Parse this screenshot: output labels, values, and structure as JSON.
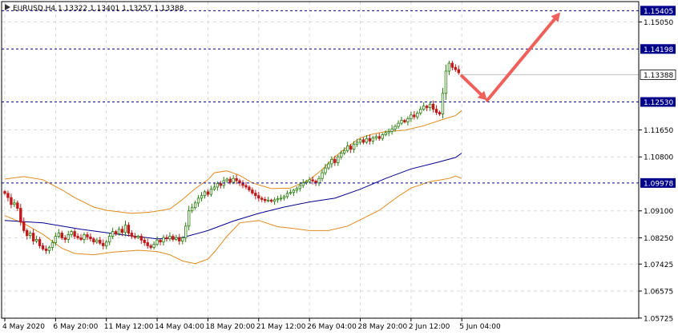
{
  "chart_data": {
    "type": "candlestick",
    "title": "EURUSD,H4  1.13322 1.13401 1.13257 1.13388",
    "ylim": [
      1.0572,
      1.1569
    ],
    "y_ticks": [
      {
        "value": 1.1505,
        "label": "1.15050"
      },
      {
        "value": 1.1165,
        "label": "1.11650"
      },
      {
        "value": 1.108,
        "label": "1.10800"
      },
      {
        "value": 1.091,
        "label": "1.09100"
      },
      {
        "value": 1.0825,
        "label": "1.08250"
      },
      {
        "value": 1.07425,
        "label": "1.07425"
      },
      {
        "value": 1.06575,
        "label": "1.06575"
      },
      {
        "value": 1.05725,
        "label": "1.05725"
      }
    ],
    "x_ticks": [
      {
        "bar": 0,
        "label": "4 May 2020"
      },
      {
        "bar": 16,
        "label": "6 May 20:00"
      },
      {
        "bar": 32,
        "label": "11 May 12:00"
      },
      {
        "bar": 48,
        "label": "14 May 04:00"
      },
      {
        "bar": 64,
        "label": "18 May 20:00"
      },
      {
        "bar": 80,
        "label": "21 May 12:00"
      },
      {
        "bar": 96,
        "label": "26 May 04:00"
      },
      {
        "bar": 112,
        "label": "28 May 20:00"
      },
      {
        "bar": 128,
        "label": "2 Jun 12:00"
      },
      {
        "bar": 144,
        "label": "5 Jun 04:00"
      }
    ],
    "horizontal_levels": [
      {
        "value": 1.15405,
        "label": "1.15405",
        "style": "dashed"
      },
      {
        "value": 1.14198,
        "label": "1.14198",
        "style": "dashed"
      },
      {
        "value": 1.13388,
        "label": "1.13388",
        "style": "current"
      },
      {
        "value": 1.1253,
        "label": "1.12530",
        "style": "dashed"
      },
      {
        "value": 1.09978,
        "label": "1.09978",
        "style": "dashed"
      }
    ],
    "series": [
      {
        "type": "close",
        "values": [
          1.0965,
          1.0952,
          1.093,
          1.0935,
          1.0918,
          1.0875,
          1.0848,
          1.0832,
          1.084,
          1.0815,
          1.082,
          1.08,
          1.079,
          1.0785,
          1.0795,
          1.081,
          1.083,
          1.084,
          1.0825,
          1.082,
          1.0835,
          1.0845,
          1.083,
          1.0825,
          1.082,
          1.0835,
          1.0828,
          1.0822,
          1.0812,
          1.0818,
          1.0808,
          1.08,
          1.0812,
          1.083,
          1.0845,
          1.0838,
          1.0852,
          1.0842,
          1.0865,
          1.084,
          1.083,
          1.0826,
          1.083,
          1.0818,
          1.081,
          1.08,
          1.0795,
          1.0805,
          1.0818,
          1.0812,
          1.0826,
          1.0822,
          1.083,
          1.082,
          1.0826,
          1.0815,
          1.0825,
          1.0862,
          1.091,
          1.092,
          1.0935,
          1.095,
          1.0958,
          1.097,
          1.0962,
          1.0978,
          1.0985,
          1.0996,
          1.099,
          1.1005,
          1.101,
          1.1,
          1.1012,
          1.1005,
          1.0998,
          1.099,
          1.0985,
          1.0976,
          1.0966,
          1.0958,
          1.095,
          1.0946,
          1.0942,
          1.0944,
          1.094,
          1.0945,
          1.0948,
          1.095,
          1.0955,
          1.0965,
          1.0968,
          1.0975,
          1.098,
          1.099,
          1.0998,
          1.1002,
          1.1008,
          1.1004,
          1.0998,
          1.1012,
          1.103,
          1.1045,
          1.1058,
          1.1072,
          1.1062,
          1.108,
          1.1092,
          1.11,
          1.1114,
          1.1104,
          1.112,
          1.1126,
          1.1134,
          1.1126,
          1.1138,
          1.113,
          1.114,
          1.1144,
          1.1138,
          1.115,
          1.1156,
          1.116,
          1.1168,
          1.1176,
          1.1186,
          1.1195,
          1.119,
          1.12,
          1.1212,
          1.1206,
          1.1218,
          1.123,
          1.124,
          1.1235,
          1.1246,
          1.123,
          1.122,
          1.1215,
          1.128,
          1.135,
          1.1375,
          1.1362,
          1.1355,
          1.1345
        ]
      },
      {
        "type": "moving_average",
        "name": "",
        "color": "#00008b",
        "points": [
          [
            0,
            1.088
          ],
          [
            12,
            1.0872
          ],
          [
            24,
            1.0852
          ],
          [
            36,
            1.0836
          ],
          [
            48,
            1.0822
          ],
          [
            56,
            1.0826
          ],
          [
            64,
            1.0848
          ],
          [
            72,
            1.0878
          ],
          [
            80,
            1.0902
          ],
          [
            88,
            1.0922
          ],
          [
            96,
            1.0938
          ],
          [
            104,
            1.095
          ],
          [
            112,
            1.0978
          ],
          [
            120,
            1.1012
          ],
          [
            128,
            1.1042
          ],
          [
            136,
            1.1062
          ],
          [
            142,
            1.1078
          ],
          [
            144,
            1.1092
          ]
        ]
      },
      {
        "type": "bollinger_upper",
        "name": "",
        "color": "#e08a1e",
        "points": [
          [
            0,
            1.101
          ],
          [
            6,
            1.1018
          ],
          [
            12,
            1.1008
          ],
          [
            18,
            1.0976
          ],
          [
            22,
            1.0952
          ],
          [
            28,
            1.0922
          ],
          [
            32,
            1.0912
          ],
          [
            40,
            1.0902
          ],
          [
            46,
            1.0906
          ],
          [
            52,
            1.0916
          ],
          [
            56,
            1.0946
          ],
          [
            60,
            1.098
          ],
          [
            64,
            1.1008
          ],
          [
            66,
            1.103
          ],
          [
            70,
            1.1036
          ],
          [
            74,
            1.1022
          ],
          [
            78,
            1.0998
          ],
          [
            84,
            1.098
          ],
          [
            90,
            1.0982
          ],
          [
            96,
            1.1008
          ],
          [
            100,
            1.104
          ],
          [
            104,
            1.108
          ],
          [
            108,
            1.1112
          ],
          [
            112,
            1.114
          ],
          [
            116,
            1.1152
          ],
          [
            120,
            1.116
          ],
          [
            126,
            1.1164
          ],
          [
            132,
            1.1178
          ],
          [
            138,
            1.1198
          ],
          [
            142,
            1.121
          ],
          [
            144,
            1.1226
          ]
        ]
      },
      {
        "type": "bollinger_lower",
        "name": "",
        "color": "#e08a1e",
        "points": [
          [
            0,
            1.0895
          ],
          [
            6,
            1.087
          ],
          [
            12,
            1.0836
          ],
          [
            18,
            1.0792
          ],
          [
            22,
            1.0776
          ],
          [
            28,
            1.0772
          ],
          [
            34,
            1.078
          ],
          [
            42,
            1.0786
          ],
          [
            48,
            1.0782
          ],
          [
            52,
            1.0772
          ],
          [
            56,
            1.0752
          ],
          [
            60,
            1.0744
          ],
          [
            64,
            1.0758
          ],
          [
            66,
            1.078
          ],
          [
            70,
            1.083
          ],
          [
            74,
            1.0872
          ],
          [
            80,
            1.088
          ],
          [
            86,
            1.086
          ],
          [
            90,
            1.0856
          ],
          [
            96,
            1.0848
          ],
          [
            102,
            1.0848
          ],
          [
            108,
            1.0862
          ],
          [
            112,
            1.0882
          ],
          [
            118,
            1.0912
          ],
          [
            124,
            1.0956
          ],
          [
            128,
            1.0982
          ],
          [
            134,
            1.1002
          ],
          [
            140,
            1.1012
          ],
          [
            142,
            1.102
          ],
          [
            144,
            1.1012
          ]
        ]
      }
    ],
    "arrows": [
      {
        "from": [
          144,
          1.1335
        ],
        "to": [
          152,
          1.1258
        ],
        "color": "#f0605a"
      },
      {
        "from": [
          152,
          1.1258
        ],
        "to": [
          175,
          1.1535
        ],
        "color": "#f0605a"
      }
    ],
    "colors": {
      "up": "#2a7d0f",
      "down": "#c0191b",
      "level": "#00008b",
      "grid": "#d9d9d9"
    }
  }
}
